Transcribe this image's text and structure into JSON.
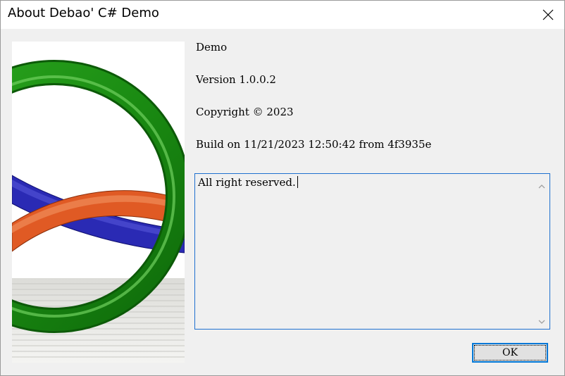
{
  "window": {
    "title": "About Debao' C# Demo"
  },
  "info": {
    "product": "Demo",
    "version": "Version 1.0.0.2",
    "copyright": "Copyright © 2023",
    "build": "Build on 11/21/2023 12:50:42 from 4f3935e"
  },
  "description": {
    "text": "All right reserved."
  },
  "buttons": {
    "ok_label": "OK"
  },
  "icons": {
    "close": "close-icon",
    "logo": "product-logo-image",
    "scroll_up": "chevron-up-icon",
    "scroll_down": "chevron-down-icon"
  },
  "colors": {
    "titlebar": "#ffffff",
    "dialog_bg": "#f0f0f0",
    "focus_border": "#0078d7"
  }
}
